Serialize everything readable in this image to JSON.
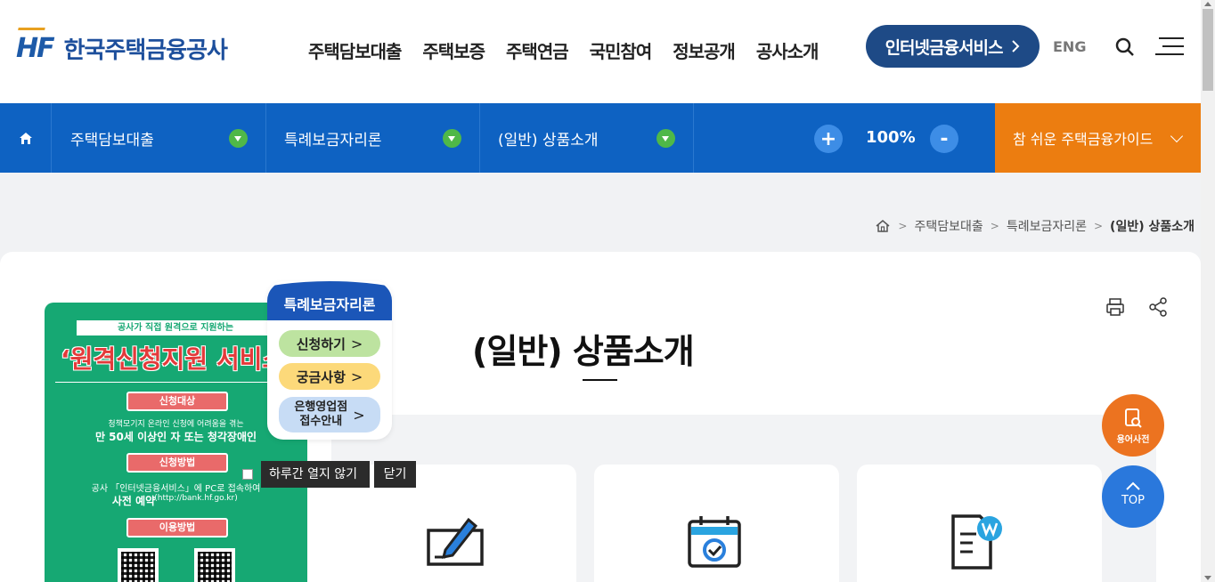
{
  "header": {
    "logo_mark": "HF",
    "logo_text": "한국주택금융공사",
    "nav": [
      "주택담보대출",
      "주택보증",
      "주택연금",
      "국민참여",
      "정보공개",
      "공사소개"
    ],
    "internet_service": "인터넷금융서비스",
    "lang": "ENG"
  },
  "locbar": {
    "depth1": "주택담보대출",
    "depth2": "특례보금자리론",
    "depth3": "(일반) 상품소개",
    "zoom_plus": "+",
    "zoom": "100%",
    "zoom_minus": "-",
    "guide": "참 쉬운 주택금융가이드"
  },
  "breadcrumb": [
    "주택담보대출",
    "특례보금자리론",
    "(일반) 상품소개"
  ],
  "page": {
    "title": "(일반) 상품소개"
  },
  "popup": {
    "top_banner": "공사가 직접 원격으로 지원하는",
    "headline": "‘원격신청지원 서비스",
    "target_label": "신청대상",
    "target_small": "청책모기지 온라인 신청에 어려움을 겪는",
    "target_big": "만 50세 이상인 자 또는 청각장애인",
    "method_label": "신청방법",
    "method_text": "공사 「인터넷금융서비스」에 PC로 접속하여",
    "method_big": "사전 예약",
    "method_url": "(http://bank.hf.go.kr)",
    "usage_label": "이용방법",
    "badge_title": "특례보금자리론",
    "btn_apply": "신청하기",
    "btn_faq": "궁금사항",
    "btn_branch_1": "은행영업점",
    "btn_branch_2": "접수안내",
    "gt": ">",
    "no_more_today": "하루간 열지 않기",
    "close": "닫기"
  },
  "floating": {
    "dictionary": "용어사전",
    "top": "TOP"
  },
  "colors": {
    "brand_blue": "#0e62c2",
    "navy": "#1e4a86",
    "orange": "#ec7d10",
    "green": "#16a873"
  }
}
